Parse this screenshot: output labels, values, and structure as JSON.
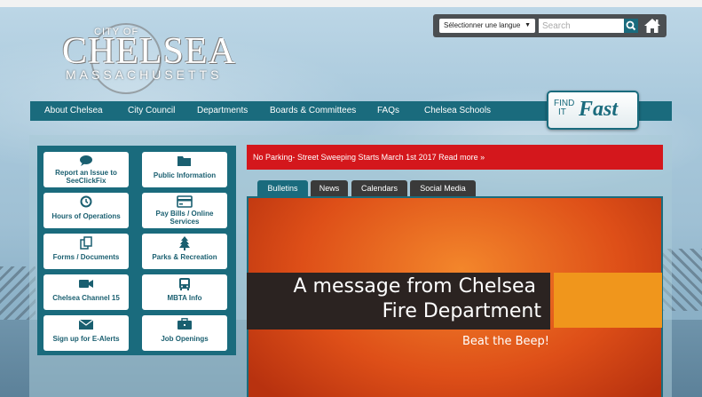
{
  "logo": {
    "city": "CITY OF",
    "name": "CHELSEA",
    "state": "MASSACHUSETTS"
  },
  "utility": {
    "language_select": "Sélectionner une langue",
    "search_placeholder": "Search",
    "search_icon": "search-icon",
    "home_icon": "home-icon"
  },
  "nav": {
    "items": [
      "About Chelsea",
      "City Council",
      "Departments",
      "Boards & Committees",
      "FAQs",
      "Chelsea Schools"
    ]
  },
  "find_it_fast": {
    "find": "FIND",
    "it": "IT",
    "fast": "Fast"
  },
  "tiles": [
    {
      "label": "Report an Issue to SeeClickFix",
      "icon": "speech-bubble-icon"
    },
    {
      "label": "Public Information",
      "icon": "folder-icon"
    },
    {
      "label": "Hours of Operations",
      "icon": "clock-icon"
    },
    {
      "label": "Pay Bills / Online Services",
      "icon": "credit-card-icon"
    },
    {
      "label": "Forms / Documents",
      "icon": "documents-icon"
    },
    {
      "label": "Parks & Recreation",
      "icon": "tree-icon"
    },
    {
      "label": "Chelsea Channel 15",
      "icon": "video-camera-icon"
    },
    {
      "label": "MBTA Info",
      "icon": "bus-icon"
    },
    {
      "label": "Sign up for E-Alerts",
      "icon": "envelope-icon"
    },
    {
      "label": "Job Openings",
      "icon": "briefcase-icon"
    }
  ],
  "alert": {
    "text": "No Parking- Street Sweeping Starts March 1st 2017 Read more »"
  },
  "tabs": [
    "Bulletins",
    "News",
    "Calendars",
    "Social Media"
  ],
  "active_tab": "Bulletins",
  "feature": {
    "line1": "A message from Chelsea",
    "line2": "Fire Department",
    "sub": "Beat the Beep!"
  },
  "colors": {
    "primary": "#1a6b7d",
    "alert": "#d4171c",
    "accent": "#f0961c"
  }
}
